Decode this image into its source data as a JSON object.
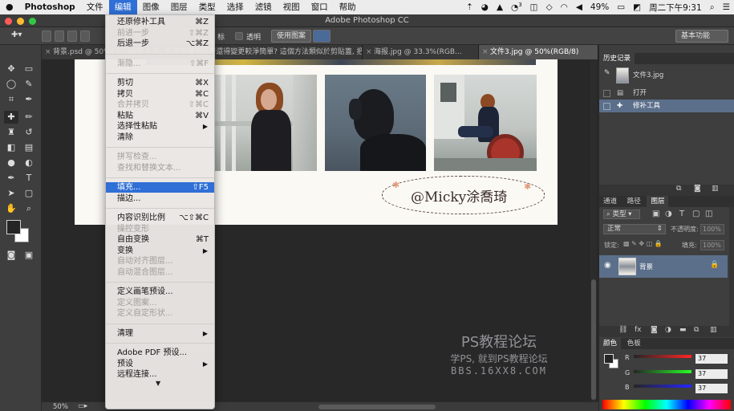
{
  "macbar": {
    "apple": "",
    "app_name": "Photoshop",
    "menus": [
      "文件",
      "编辑",
      "图像",
      "图层",
      "类型",
      "选择",
      "滤镜",
      "视图",
      "窗口",
      "帮助"
    ],
    "active_menu": "编辑",
    "right": {
      "badge_count": "3",
      "battery": "49%",
      "clock": "周二下午9:31"
    }
  },
  "titlebar": {
    "title": "Adobe Photoshop CC"
  },
  "options": {
    "mode_label": "标",
    "transparent_label": "透明",
    "use_pattern_btn": "使用图案",
    "workspace": "基本功能"
  },
  "tabs": [
    {
      "label": "背景.psd @ 50%",
      "active": false
    },
    {
      "label": "[...]百變身子...看宣傳懶宣是否還得變更較淨簡單? 這個方法類似於剪貼蓋, 把自...",
      "active": false
    },
    {
      "label": "海报.jpg @ 33.3%(RGB...",
      "active": false
    },
    {
      "label": "文件3.jpg @ 50%(RGB/8)",
      "active": true
    }
  ],
  "document": {
    "signature": "@Micky涂喬琦"
  },
  "watermark": {
    "line1": "PS教程论坛",
    "line2": "学PS, 就到PS教程论坛",
    "line3": "BBS.16XX8.COM"
  },
  "status": {
    "zoom": "50%"
  },
  "history": {
    "tab": "历史记录",
    "snapshot": "文件3.jpg",
    "items": [
      {
        "label": "打开",
        "selected": false
      },
      {
        "label": "修补工具",
        "selected": true
      }
    ]
  },
  "layers": {
    "tabs": [
      "通道",
      "路径",
      "图层"
    ],
    "active_tab": "图层",
    "kind_label": "类型",
    "blend_mode": "正常",
    "opacity_label": "不透明度:",
    "opacity_value": "100%",
    "lock_label": "锁定:",
    "fill_label": "填充:",
    "fill_value": "100%",
    "layer_name": "背景"
  },
  "color_panel": {
    "tabs": [
      "颜色",
      "色板"
    ],
    "r_label": "R",
    "r_value": "37",
    "g_label": "G",
    "g_value": "37",
    "b_label": "B",
    "b_value": "37"
  },
  "edit_menu": {
    "items": [
      {
        "label": "还原修补工具",
        "shortcut": "⌘Z",
        "disabled": false
      },
      {
        "label": "前进一步",
        "shortcut": "⇧⌘Z",
        "disabled": true
      },
      {
        "label": "后退一步",
        "shortcut": "⌥⌘Z",
        "disabled": false
      },
      {
        "sep": true
      },
      {
        "label": "渐隐...",
        "shortcut": "⇧⌘F",
        "disabled": true
      },
      {
        "sep": true
      },
      {
        "label": "剪切",
        "shortcut": "⌘X",
        "disabled": false
      },
      {
        "label": "拷贝",
        "shortcut": "⌘C",
        "disabled": false
      },
      {
        "label": "合并拷贝",
        "shortcut": "⇧⌘C",
        "disabled": true
      },
      {
        "label": "粘贴",
        "shortcut": "⌘V",
        "disabled": false
      },
      {
        "label": "选择性粘贴",
        "submenu": true,
        "disabled": false
      },
      {
        "label": "清除",
        "disabled": false
      },
      {
        "sep": true
      },
      {
        "label": "拼写检查...",
        "disabled": true
      },
      {
        "label": "查找和替换文本...",
        "disabled": true
      },
      {
        "sep": true
      },
      {
        "label": "填充...",
        "shortcut": "⇧F5",
        "disabled": false,
        "highlighted": true
      },
      {
        "label": "描边...",
        "disabled": false
      },
      {
        "sep": true
      },
      {
        "label": "内容识别比例",
        "shortcut": "⌥⇧⌘C",
        "disabled": false
      },
      {
        "label": "操控变形",
        "disabled": true
      },
      {
        "label": "自由变换",
        "shortcut": "⌘T",
        "disabled": false
      },
      {
        "label": "变换",
        "submenu": true,
        "disabled": false
      },
      {
        "label": "自动对齐图层...",
        "disabled": true
      },
      {
        "label": "自动混合图层...",
        "disabled": true
      },
      {
        "sep": true
      },
      {
        "label": "定义画笔预设...",
        "disabled": false
      },
      {
        "label": "定义图案...",
        "disabled": true
      },
      {
        "label": "定义自定形状...",
        "disabled": true
      },
      {
        "sep": true
      },
      {
        "label": "清理",
        "submenu": true,
        "disabled": false
      },
      {
        "sep": true
      },
      {
        "label": "Adobe PDF 预设...",
        "disabled": false
      },
      {
        "label": "预设",
        "submenu": true,
        "disabled": false
      },
      {
        "label": "远程连接...",
        "disabled": false
      }
    ]
  }
}
